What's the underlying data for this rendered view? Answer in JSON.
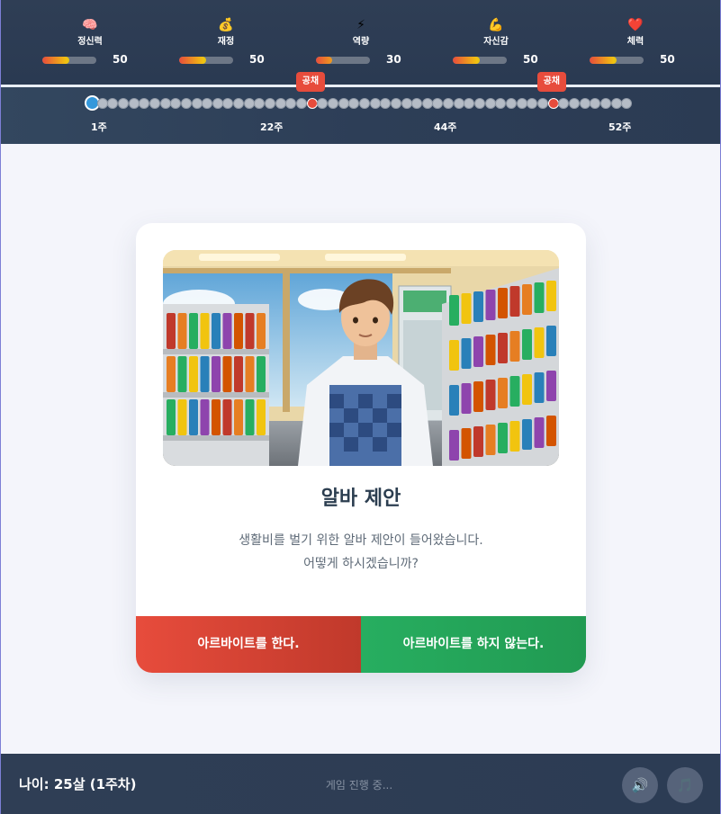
{
  "stats": [
    {
      "emoji": "🧠",
      "label": "정신력",
      "value": "50",
      "level": 0.5
    },
    {
      "emoji": "💰",
      "label": "재정",
      "value": "50",
      "level": 0.5
    },
    {
      "emoji": "⚡",
      "label": "역량",
      "value": "30",
      "level": 0.3
    },
    {
      "emoji": "💪",
      "label": "자신감",
      "value": "50",
      "level": 0.5
    },
    {
      "emoji": "❤️",
      "label": "체력",
      "value": "50",
      "level": 0.5
    }
  ],
  "timeline": {
    "total_weeks": 52,
    "current_week": 1,
    "events": [
      {
        "week": 22,
        "label": "공채"
      },
      {
        "week": 45,
        "label": "공채"
      }
    ],
    "week_labels": [
      "1주",
      "22주",
      "44주",
      "52주"
    ]
  },
  "card": {
    "title": "알바 제안",
    "description_line1": "생활비를 벌기 위한 알바 제안이 들어왔습니다.",
    "description_line2": "어떻게 하시겠습니까?",
    "accept_label": "아르바이트를 한다.",
    "decline_label": "아르바이트를 하지 않는다.",
    "accept_color": "#e74c3c",
    "decline_color": "#27ae60"
  },
  "footer": {
    "age": "나이: 25살 (1주차)",
    "status": "게임 진행 중...",
    "sound_icon": "🔊",
    "music_icon": "🎵"
  }
}
